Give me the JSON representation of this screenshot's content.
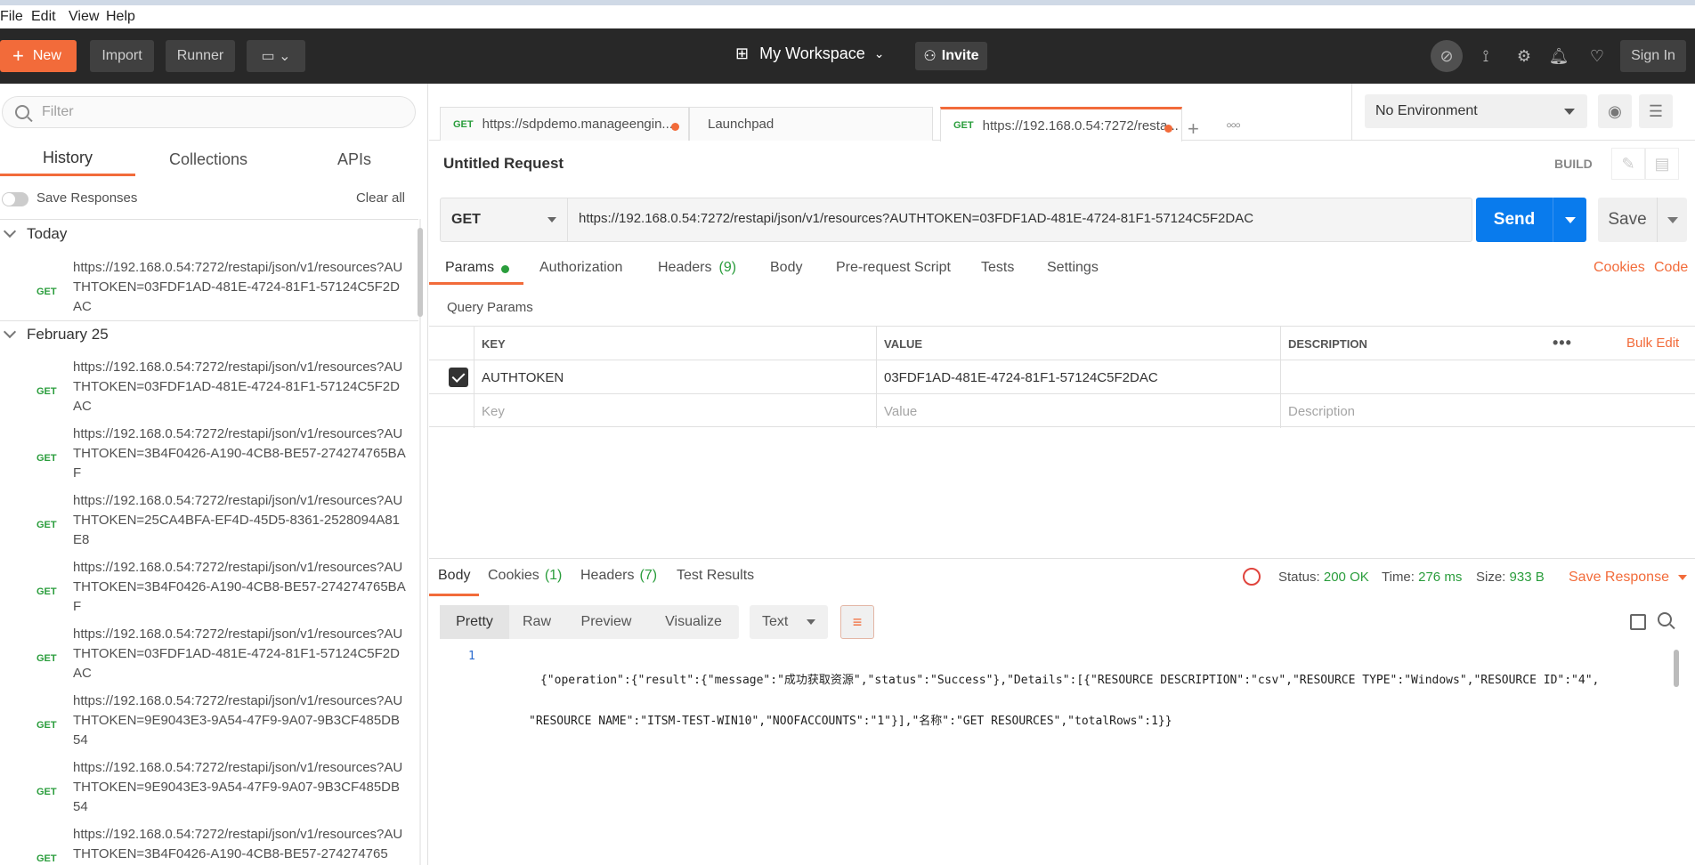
{
  "menubar": {
    "file": "File",
    "edit": "Edit",
    "view": "View",
    "help": "Help"
  },
  "header": {
    "new_label": "New",
    "import_label": "Import",
    "runner_label": "Runner",
    "workspace_label": "My Workspace",
    "invite_label": "Invite",
    "signin_label": "Sign In"
  },
  "sidebar": {
    "filter_placeholder": "Filter",
    "tabs": [
      "History",
      "Collections",
      "APIs"
    ],
    "save_responses_label": "Save Responses",
    "clear_all_label": "Clear all",
    "groups": [
      {
        "title": "Today",
        "items": [
          {
            "method": "GET",
            "url": "https://192.168.0.54:7272/restapi/json/v1/resources?AUTHTOKEN=03FDF1AD-481E-4724-81F1-57124C5F2DAC"
          }
        ]
      },
      {
        "title": "February 25",
        "items": [
          {
            "method": "GET",
            "url": "https://192.168.0.54:7272/restapi/json/v1/resources?AUTHTOKEN=03FDF1AD-481E-4724-81F1-57124C5F2DAC"
          },
          {
            "method": "GET",
            "url": "https://192.168.0.54:7272/restapi/json/v1/resources?AUTHTOKEN=3B4F0426-A190-4CB8-BE57-274274765BAF"
          },
          {
            "method": "GET",
            "url": "https://192.168.0.54:7272/restapi/json/v1/resources?AUTHTOKEN=25CA4BFA-EF4D-45D5-8361-2528094A81E8"
          },
          {
            "method": "GET",
            "url": "https://192.168.0.54:7272/restapi/json/v1/resources?AUTHTOKEN=3B4F0426-A190-4CB8-BE57-274274765BAF"
          },
          {
            "method": "GET",
            "url": "https://192.168.0.54:7272/restapi/json/v1/resources?AUTHTOKEN=03FDF1AD-481E-4724-81F1-57124C5F2DAC"
          },
          {
            "method": "GET",
            "url": "https://192.168.0.54:7272/restapi/json/v1/resources?AUTHTOKEN=9E9043E3-9A54-47F9-9A07-9B3CF485DB54"
          },
          {
            "method": "GET",
            "url": "https://192.168.0.54:7272/restapi/json/v1/resources?AUTHTOKEN=9E9043E3-9A54-47F9-9A07-9B3CF485DB54"
          },
          {
            "method": "GET",
            "url": "https://192.168.0.54:7272/restapi/json/v1/resources?AUTHTOKEN=3B4F0426-A190-4CB8-BE57-274274765"
          }
        ]
      }
    ]
  },
  "request_tabs": [
    {
      "method": "GET",
      "label": "https://sdpdemo.manageengin...",
      "unsaved": true
    },
    {
      "method": "",
      "label": "Launchpad",
      "unsaved": false
    },
    {
      "method": "GET",
      "label": "https://192.168.0.54:7272/resta...",
      "unsaved": true,
      "active": true
    }
  ],
  "environment": {
    "selected": "No Environment"
  },
  "request": {
    "title": "Untitled Request",
    "build_label": "BUILD",
    "method": "GET",
    "url": "https://192.168.0.54:7272/restapi/json/v1/resources?AUTHTOKEN=03FDF1AD-481E-4724-81F1-57124C5F2DAC",
    "send_label": "Send",
    "save_label": "Save"
  },
  "param_tabs": {
    "params": "Params",
    "authorization": "Authorization",
    "headers": "Headers",
    "headers_count": "(9)",
    "body": "Body",
    "prerequest": "Pre-request Script",
    "tests": "Tests",
    "settings": "Settings",
    "cookies": "Cookies",
    "code": "Code"
  },
  "query_params": {
    "title": "Query Params",
    "headers": {
      "key": "KEY",
      "value": "VALUE",
      "description": "DESCRIPTION",
      "bulk_edit": "Bulk Edit"
    },
    "rows": [
      {
        "checked": true,
        "key": "AUTHTOKEN",
        "value": "03FDF1AD-481E-4724-81F1-57124C5F2DAC",
        "description": ""
      }
    ],
    "placeholders": {
      "key": "Key",
      "value": "Value",
      "description": "Description"
    }
  },
  "response": {
    "tabs": {
      "body": "Body",
      "cookies": "Cookies",
      "cookies_count": "(1)",
      "headers": "Headers",
      "headers_count": "(7)",
      "tests": "Test Results"
    },
    "status_label": "Status:",
    "status_value": "200 OK",
    "time_label": "Time:",
    "time_value": "276 ms",
    "size_label": "Size:",
    "size_value": "933 B",
    "save_response_label": "Save Response",
    "views": [
      "Pretty",
      "Raw",
      "Preview",
      "Visualize"
    ],
    "format": "Text",
    "line_number": "1",
    "body_line1": "{\"operation\":{\"result\":{\"message\":\"成功获取资源\",\"status\":\"Success\"},\"Details\":[{\"RESOURCE DESCRIPTION\":\"csv\",\"RESOURCE TYPE\":\"Windows\",\"RESOURCE ID\":\"4\",",
    "body_line2": "\"RESOURCE NAME\":\"ITSM-TEST-WIN10\",\"NOOFACCOUNTS\":\"1\"}],\"名称\":\"GET RESOURCES\",\"totalRows\":1}}"
  },
  "colors": {
    "accent": "#f26b3a",
    "primary": "#097bed",
    "success": "#2a9d3c",
    "header_bg": "#282828"
  }
}
